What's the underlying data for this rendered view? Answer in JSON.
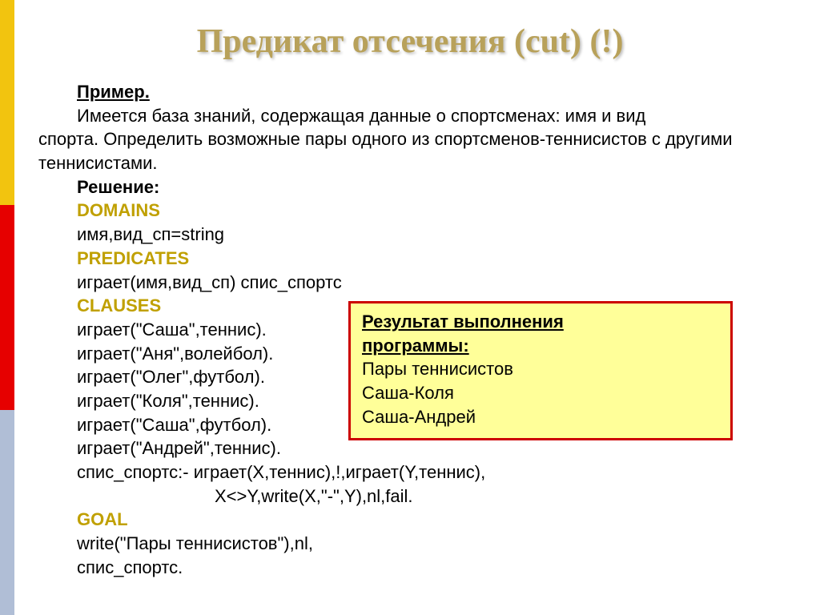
{
  "title": "Предикат отсечения  (cut) (!)",
  "intro": {
    "label": "Пример.",
    "sentence_start": "Имеется база знаний, содержащая данные о спортсменах: имя и вид",
    "sentence_cont": "спорта. Определить возможные пары одного из спортсменов-теннисистов с другими теннисистами."
  },
  "solution_label": "Решение",
  "code": {
    "domains_kw": "DOMAINS",
    "domains_line": "имя,вид_сп=string",
    "predicates_kw": "PREDICATES",
    "predicates_line": "играет(имя,вид_сп)  спис_спортс",
    "clauses_kw": "CLAUSES",
    "c1": "играет(\"Саша\",теннис).",
    "c2": "играет(\"Аня\",волейбол).",
    "c3": "играет(\"Олег\",футбол).",
    "c4": "играет(\"Коля\",теннис).",
    "c5": "играет(\"Саша\",футбол).",
    "c6": "играет(\"Андрей\",теннис).",
    "c7": "спис_спортс:- играет(X,теннис),!,играет(Y,теннис),",
    "c7b": "X<>Y,write(X,\"-\",Y),nl,fail.",
    "goal_kw": "GOAL",
    "g1": "write(\"Пары теннисистов\"),nl,",
    "g2": "спис_спортс."
  },
  "result": {
    "heading1": "Результат выполнения",
    "heading2": "программы:",
    "r1": "Пары теннисистов",
    "r2": "Саша-Коля",
    "r3": "Саша-Андрей"
  }
}
